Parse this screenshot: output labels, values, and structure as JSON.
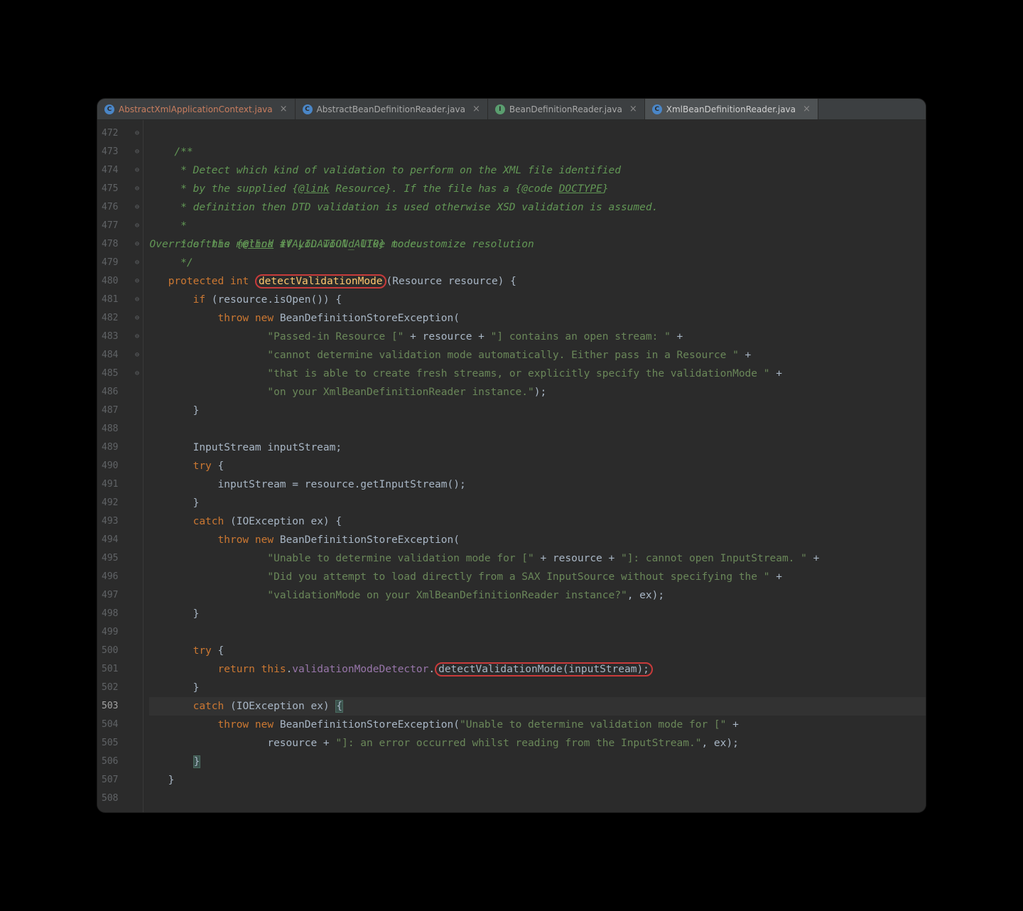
{
  "tabs": [
    {
      "icon": "C",
      "iconClass": "icon-class",
      "label": "AbstractXmlApplicationContext.java",
      "highlighted": true,
      "active": false
    },
    {
      "icon": "C",
      "iconClass": "icon-class",
      "label": "AbstractBeanDefinitionReader.java",
      "highlighted": false,
      "active": false
    },
    {
      "icon": "I",
      "iconClass": "icon-interface",
      "label": "BeanDefinitionReader.java",
      "highlighted": false,
      "active": false
    },
    {
      "icon": "C",
      "iconClass": "icon-class",
      "label": "XmlBeanDefinitionReader.java",
      "highlighted": false,
      "active": true
    }
  ],
  "gutter": {
    "start": 472,
    "end": 508,
    "current": 503
  },
  "code": {
    "doc1": "/**",
    "doc2": " * Detect which kind of validation to perform on the XML file identified",
    "doc3_a": " * by the supplied {",
    "doc3_link": "@link",
    "doc3_res": " Resource",
    "doc3_b": "}. If the file has a {",
    "doc3_code": "@code ",
    "doc3_doctype": "DOCTYPE",
    "doc3_c": "}",
    "doc4": " * definition then DTD validation is used otherwise XSD validation is assumed.",
    "doc5": " * <p>Override this method if you would like to customize resolution",
    "doc6_a": " * of the {",
    "doc6_link": "@link",
    "doc6_val": " #VALIDATION_AUTO",
    "doc6_b": "} mode.",
    "doc7": " */",
    "kw_protected": "protected",
    "kw_int": "int",
    "method_name": "detectValidationMode",
    "param_type": "Resource",
    "param_name": "resource",
    "kw_if": "if",
    "isOpen": "isOpen",
    "kw_throw": "throw",
    "kw_new": "new",
    "exc_type": "BeanDefinitionStoreException",
    "str1": "\"Passed-in Resource [\"",
    "str2": "\"] contains an open stream: \"",
    "str3": "\"cannot determine validation mode automatically. Either pass in a Resource \"",
    "str4": "\"that is able to create fresh streams, or explicitly specify the validationMode \"",
    "str5": "\"on your XmlBeanDefinitionReader instance.\"",
    "type_is": "InputStream",
    "var_is": "inputStream",
    "kw_try": "try",
    "getIS": "getInputStream",
    "kw_catch": "catch",
    "ioex": "IOException",
    "ex": "ex",
    "str6": "\"Unable to determine validation mode for [\"",
    "str7": "\"]: cannot open InputStream. \"",
    "str8": "\"Did you attempt to load directly from a SAX InputSource without specifying the \"",
    "str9": "\"validationMode on your XmlBeanDefinitionReader instance?\"",
    "kw_return": "return",
    "kw_this": "this",
    "detector": "validationModeDetector",
    "call": "detectValidationMode(inputStream)",
    "str10": "\"Unable to determine validation mode for [\"",
    "str11": "\"]: an error occurred whilst reading from the InputStream.\""
  }
}
